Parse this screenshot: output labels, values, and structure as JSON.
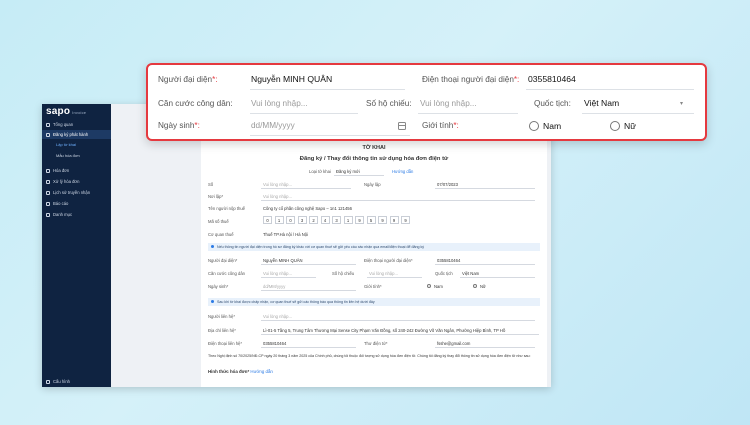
{
  "sidebar": {
    "logo": "sapo",
    "logo_sub": "Invoice",
    "items": [
      {
        "label": "Tổng quan"
      },
      {
        "label": "Đăng ký phát hành"
      },
      {
        "label": "Hóa đơn"
      },
      {
        "label": "Xử lý hóa đơn"
      },
      {
        "label": "Lịch sử truyền nhận"
      },
      {
        "label": "Báo cáo"
      },
      {
        "label": "Danh mục"
      }
    ],
    "subitems": [
      {
        "label": "Lập tờ khai"
      },
      {
        "label": "Mẫu hóa đơn"
      }
    ],
    "footer": "Cấu hình"
  },
  "form": {
    "title": "TỜ KHAI",
    "subtitle": "Đăng ký / Thay đổi thông tin sử dụng hóa đơn điện tử",
    "type_label": "Loại tờ khai",
    "type_value": "Đăng ký mới",
    "guide": "Hướng dẫn",
    "so_label": "Số",
    "so_placeholder": "Vui lòng nhập...",
    "date_label": "Ngày lập",
    "date_value": "07/07/2023",
    "noi_label": "Nơi lập*",
    "noi_placeholder": "Vui lòng nhập...",
    "ten_label": "Tên người nộp thuế",
    "ten_value": "Công ty cổ phần công nghệ Sapo – 1n1 121456",
    "mst_label": "Mã số thuế",
    "mst_digits": [
      "0",
      "1",
      "0",
      "3",
      "2",
      "4",
      "3",
      "1",
      "9",
      "5",
      "9",
      "9",
      "9"
    ],
    "cqt_label": "Cơ quan thuế",
    "cqt_value": "Thuế TP.Hà nội / Hà Nội",
    "notice1": "Nếu thông tin người đại diện trong hồ sơ đăng ký khác với cơ quan thuế sẽ gửi yêu cầu xác nhận qua email/điện thoại để đăng ký",
    "nguoi_label": "Người đại diện*",
    "nguoi_value": "Nguyễn MINH QUÂN",
    "dt_label": "Điện thoại người đại diện*",
    "dt_value": "0355810464",
    "cccd_label": "Căn cước công dân",
    "cccd_placeholder": "Vui lòng nhập...",
    "hc_label": "Số hộ chiếu",
    "hc_placeholder": "Vui lòng nhập...",
    "qt_label": "Quốc tịch",
    "qt_value": "Việt Nam",
    "ns_label": "Ngày sinh*",
    "ns_placeholder": "dd/MM/yyyy",
    "gt_label": "Giới tính*",
    "gt_nam": "Nam",
    "gt_nu": "Nữ",
    "notice2": "Sau khi tờ khai được chấp nhận, cơ quan thuế sẽ gửi các thông báo qua thông tin liên hệ dưới đây",
    "nlh_label": "Người liên hệ*",
    "nlh_placeholder": "Vui lòng nhập...",
    "dc_label": "Địa chỉ liên hệ*",
    "dc_value": "Lì-01-5 Tầng 5, Trung Tâm Thương Mại Sense City Phạm Văn Đồng, số 240-242 Đường Võ Văn Ngân, Phường Hiệp Bình, TP Hồ",
    "dtlh_label": "Điện thoại liên hệ*",
    "dtlh_value": "0355810464",
    "email_label": "Thư điện tử*",
    "email_value": "fsshe@gmail.com",
    "law": "Theo Nghị định số 70/2025/NĐ-CP ngày 20 tháng 3 năm 2025 của Chính phủ, chúng tôi thuộc đối tượng sử dụng hóa đơn điện tử. Chúng tôi đăng ký thay đổi thông tin sử dụng hóa đơn điện tử như sau:",
    "hinh_thuc": "Hình thức hóa đơn*",
    "hinh_thuc_link": "Hướng dẫn"
  },
  "zoom": {
    "nguoi_label": "Người đại diện",
    "req": "*:",
    "nguoi_value": "Nguyễn MINH QUÂN",
    "dt_label": "Điện thoại người đại diện",
    "dt_value": "0355810464",
    "cccd_label": "Căn cước công dân:",
    "cccd_placeholder": "Vui lòng nhập...",
    "hc_label": "Số hộ chiếu:",
    "hc_placeholder": "Vui lòng nhập...",
    "qt_label": "Quốc tịch:",
    "qt_value": "Việt Nam",
    "ns_label": "Ngày sinh",
    "ns_placeholder": "dd/MM/yyyy",
    "gt_label": "Giới tính",
    "gt_nam": "Nam",
    "gt_nu": "Nữ",
    "highlight_color": "#e5393f"
  }
}
